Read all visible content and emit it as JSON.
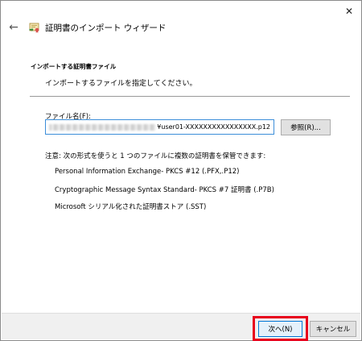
{
  "window": {
    "close_symbol": "✕"
  },
  "wizard": {
    "back_symbol": "←",
    "title": "証明書のインポート ウィザード"
  },
  "section": {
    "heading": "インポートする証明書ファイル",
    "description": "インポートするファイルを指定してください。"
  },
  "file": {
    "label": "ファイル名(F):",
    "value_visible": "¥user01-XXXXXXXXXXXXXXXX.p12",
    "browse_label": "参照(R)..."
  },
  "note": {
    "text": "注意: 次の形式を使うと 1 つのファイルに複数の証明書を保管できます:"
  },
  "formats": [
    "Personal Information Exchange- PKCS #12 (.PFX,.P12)",
    "Cryptographic Message Syntax Standard- PKCS #7 証明書 (.P7B)",
    "Microsoft シリアル化された証明書ストア (.SST)"
  ],
  "footer": {
    "next_label": "次へ(N)",
    "cancel_label": "キャンセル"
  },
  "colors": {
    "highlight": "#e8001c",
    "input_border": "#3c8ed9",
    "primary_button_border": "#0078d7"
  }
}
